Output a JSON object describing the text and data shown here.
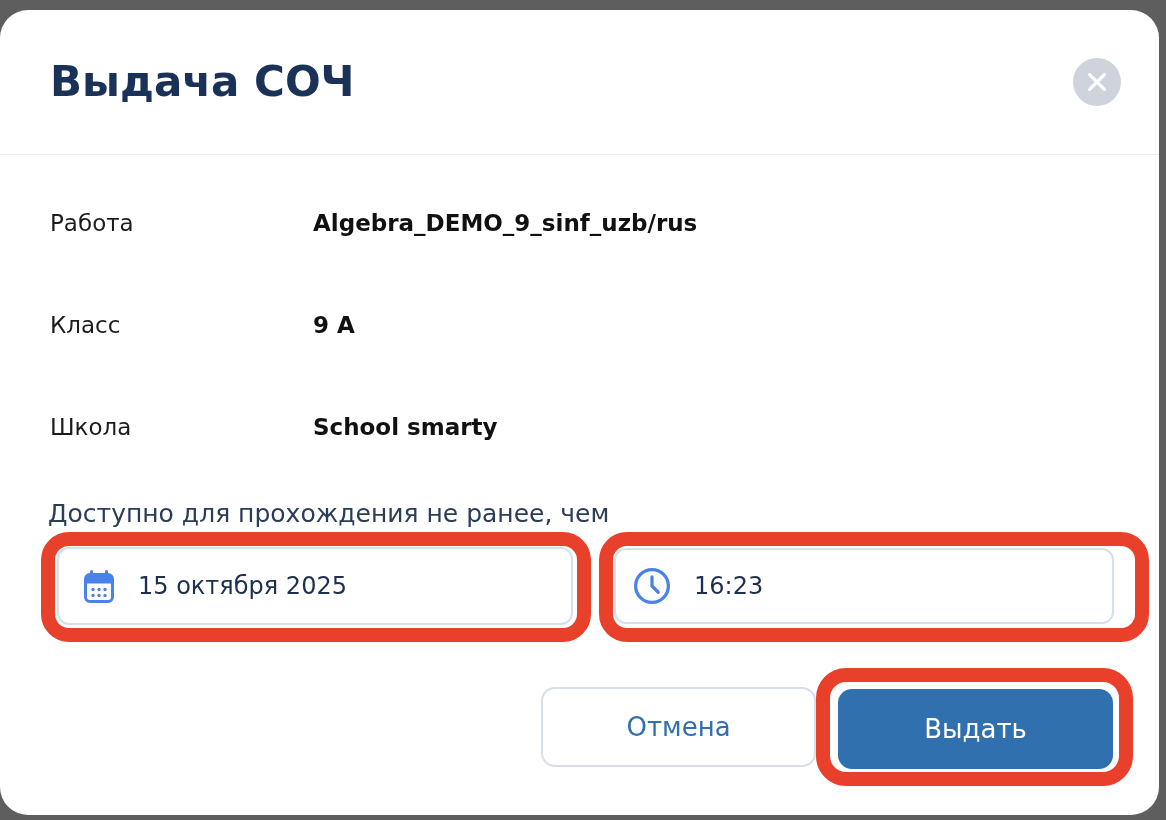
{
  "dialog": {
    "title": "Выдача СОЧ"
  },
  "details": [
    {
      "label": "Работа",
      "value": "Algebra_DEMO_9_sinf_uzb/rus"
    },
    {
      "label": "Класс",
      "value": "9 А"
    },
    {
      "label": "Школа",
      "value": "School smarty"
    }
  ],
  "availability": {
    "label": "Доступно для прохождения не ранее, чем",
    "fields": [
      {
        "kind": "date",
        "value": "15 октября 2025",
        "highlighted": true
      },
      {
        "kind": "time",
        "value": "16:23",
        "highlighted": true
      }
    ]
  },
  "buttons": [
    {
      "kind": "secondary",
      "label": "Отмена",
      "highlighted": false
    },
    {
      "kind": "primary",
      "label": "Выдать",
      "highlighted": true
    }
  ]
}
